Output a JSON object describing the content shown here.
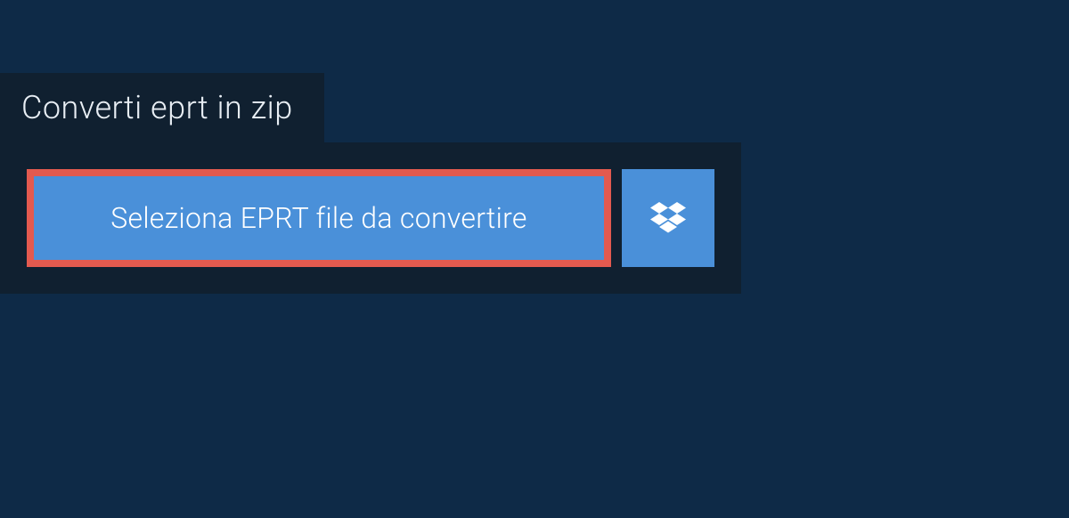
{
  "tab": {
    "title": "Converti eprt in zip"
  },
  "upload": {
    "select_label": "Seleziona EPRT file da convertire"
  },
  "colors": {
    "background": "#0e2a47",
    "panel": "#102030",
    "button": "#4a90d9",
    "highlight_border": "#e35a4f",
    "text_light": "#e8eef4",
    "text_white": "#ffffff"
  }
}
